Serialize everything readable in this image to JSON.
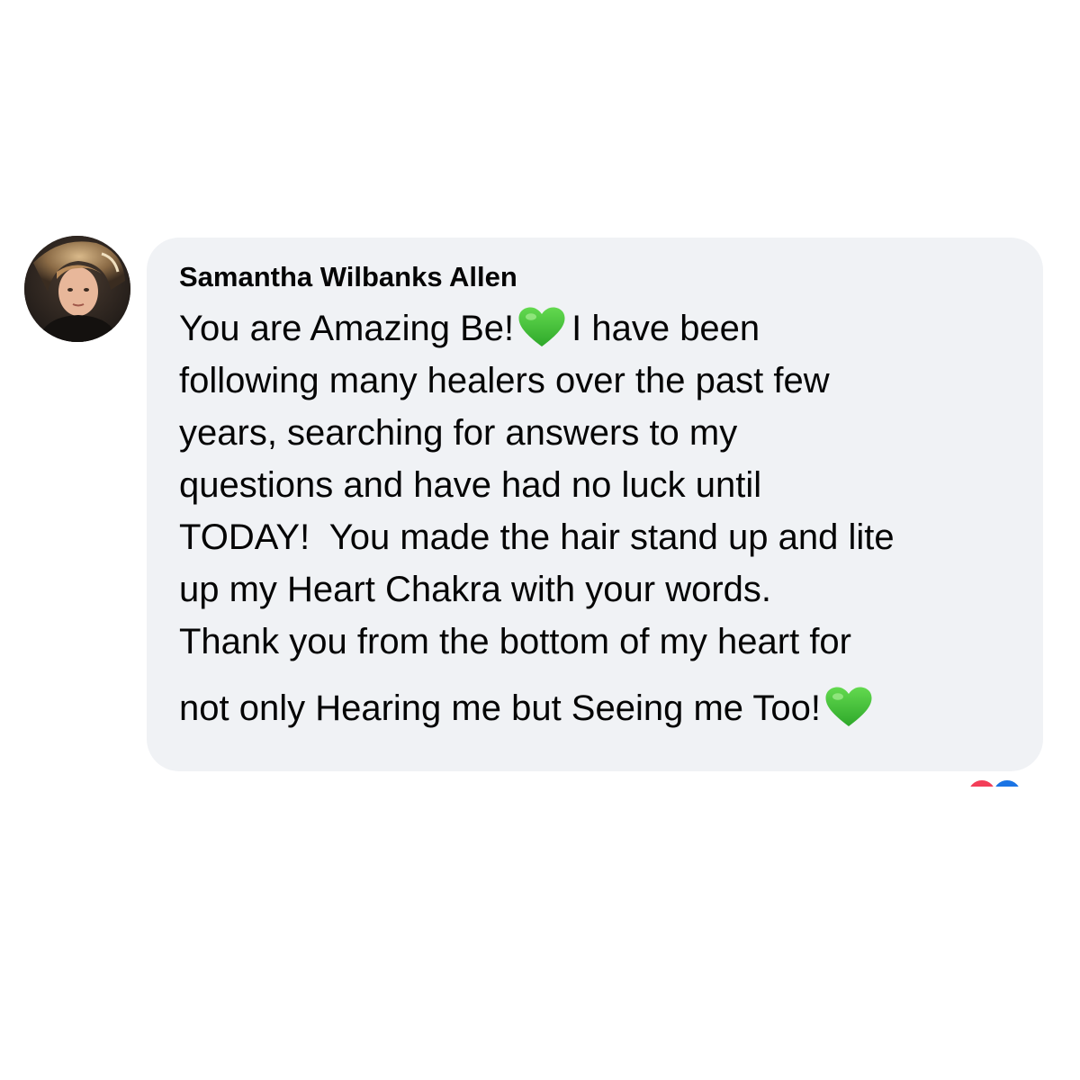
{
  "comment": {
    "author": "Samantha Wilbanks Allen",
    "lines": [
      "You are Amazing Be!",
      "I have been",
      "following many healers over the past few",
      "years, searching for answers to my",
      "questions and have had no luck until",
      "TODAY!  You made the hair stand up and lite",
      "up my Heart Chakra with your words.",
      "Thank you from the bottom of my heart for",
      "not only Hearing me but Seeing me Too!"
    ],
    "emoji": "green-heart-icon"
  },
  "reactions": [
    "love-reaction-icon",
    "like-reaction-icon"
  ],
  "colors": {
    "bubble": "#f0f2f5",
    "text": "#050505",
    "heart": "#3fc43a",
    "love": "#f33e58",
    "like": "#1b74e4"
  }
}
